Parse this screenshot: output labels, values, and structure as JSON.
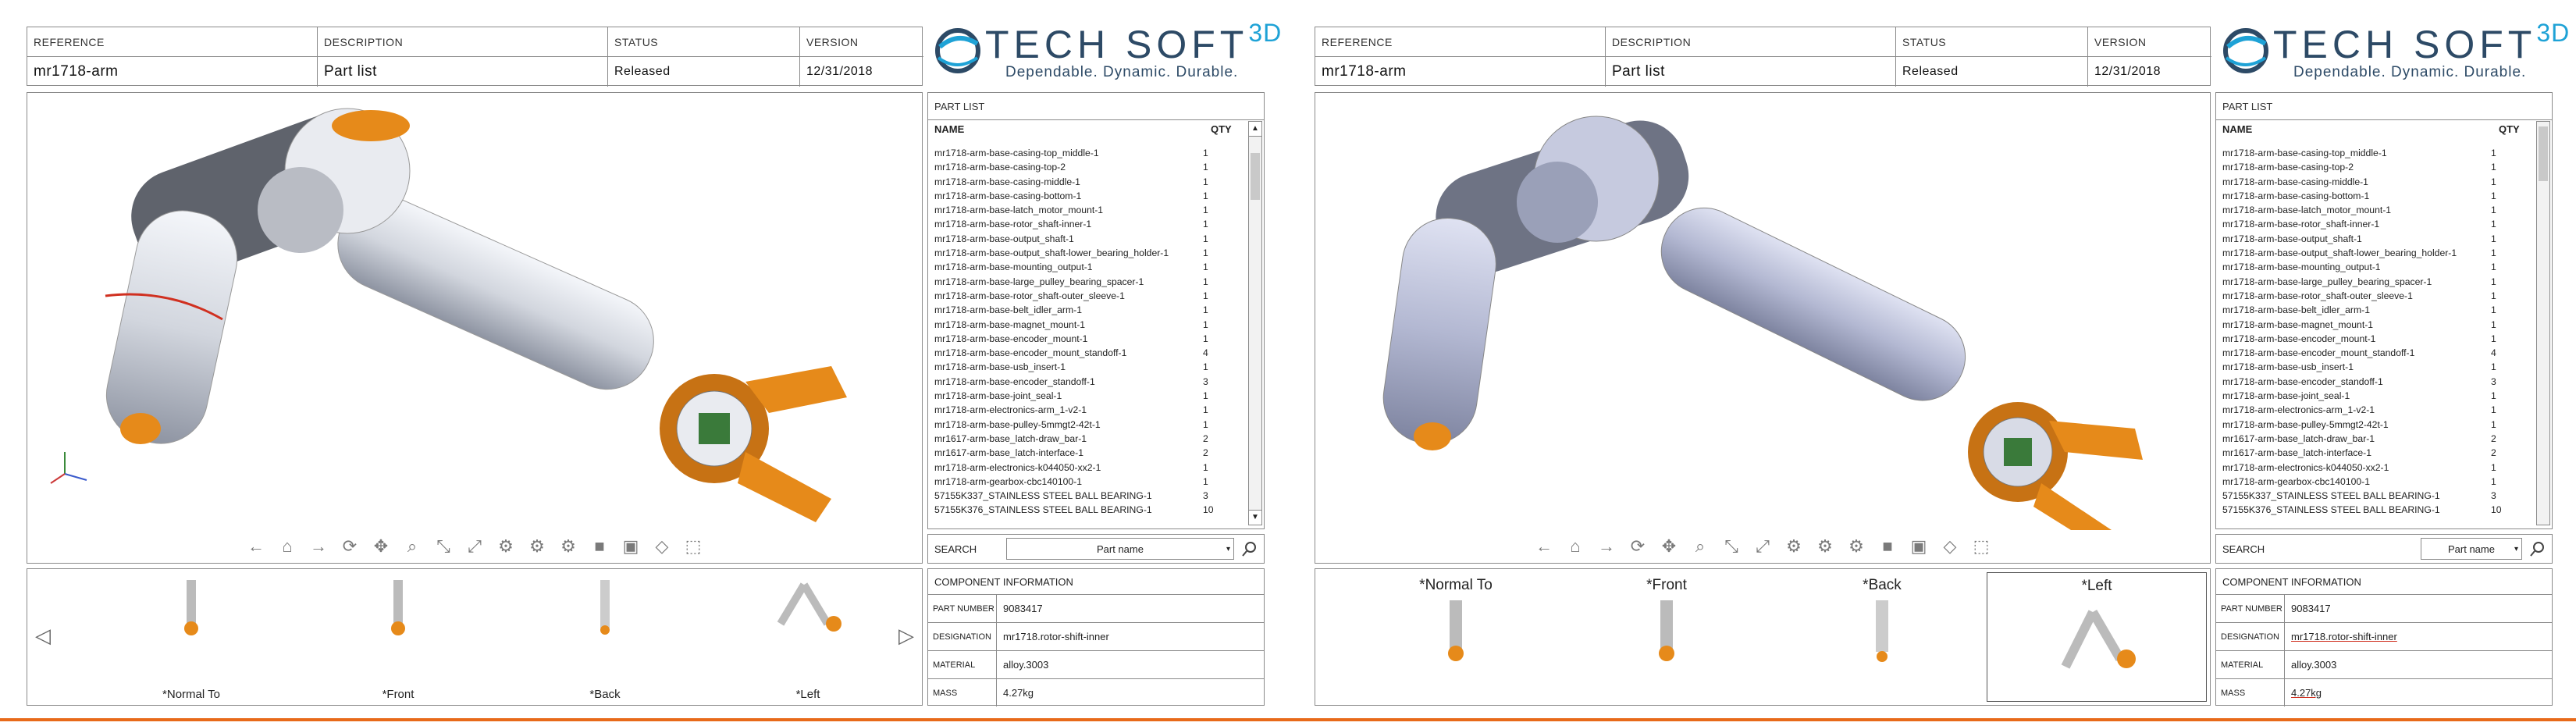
{
  "header": {
    "labels": {
      "reference": "REFERENCE",
      "description": "DESCRIPTION",
      "status": "STATUS",
      "version": "VERSION"
    },
    "values": {
      "reference": "mr1718-arm",
      "description": "Part list",
      "status": "Released",
      "version": "12/31/2018"
    }
  },
  "logo": {
    "name": "TECH SOFT",
    "suffix": "3D",
    "tagline": "Dependable. Dynamic. Durable."
  },
  "part_list": {
    "title": "PART LIST",
    "col_name": "NAME",
    "col_qty": "QTY",
    "rows": [
      {
        "name": "mr1718-arm-base-casing-top_middle-1",
        "qty": "1"
      },
      {
        "name": "mr1718-arm-base-casing-top-2",
        "qty": "1"
      },
      {
        "name": "mr1718-arm-base-casing-middle-1",
        "qty": "1"
      },
      {
        "name": "mr1718-arm-base-casing-bottom-1",
        "qty": "1"
      },
      {
        "name": "mr1718-arm-base-latch_motor_mount-1",
        "qty": "1"
      },
      {
        "name": "mr1718-arm-base-rotor_shaft-inner-1",
        "qty": "1"
      },
      {
        "name": "mr1718-arm-base-output_shaft-1",
        "qty": "1"
      },
      {
        "name": "mr1718-arm-base-output_shaft-lower_bearing_holder-1",
        "qty": "1"
      },
      {
        "name": "mr1718-arm-base-mounting_output-1",
        "qty": "1"
      },
      {
        "name": "mr1718-arm-base-large_pulley_bearing_spacer-1",
        "qty": "1"
      },
      {
        "name": "mr1718-arm-base-rotor_shaft-outer_sleeve-1",
        "qty": "1"
      },
      {
        "name": "mr1718-arm-base-belt_idler_arm-1",
        "qty": "1"
      },
      {
        "name": "mr1718-arm-base-magnet_mount-1",
        "qty": "1"
      },
      {
        "name": "mr1718-arm-base-encoder_mount-1",
        "qty": "1"
      },
      {
        "name": "mr1718-arm-base-encoder_mount_standoff-1",
        "qty": "4"
      },
      {
        "name": "mr1718-arm-base-usb_insert-1",
        "qty": "1"
      },
      {
        "name": "mr1718-arm-base-encoder_standoff-1",
        "qty": "3"
      },
      {
        "name": "mr1718-arm-base-joint_seal-1",
        "qty": "1"
      },
      {
        "name": "mr1718-arm-electronics-arm_1-v2-1",
        "qty": "1"
      },
      {
        "name": "mr1718-arm-base-pulley-5mmgt2-42t-1",
        "qty": "1"
      },
      {
        "name": "mr1617-arm-base_latch-draw_bar-1",
        "qty": "2"
      },
      {
        "name": "mr1617-arm-base_latch-interface-1",
        "qty": "2"
      },
      {
        "name": "mr1718-arm-electronics-k044050-xx2-1",
        "qty": "1"
      },
      {
        "name": "mr1718-arm-gearbox-cbc140100-1",
        "qty": "1"
      },
      {
        "name": "57155K337_STAINLESS STEEL BALL BEARING-1",
        "qty": "3"
      },
      {
        "name": "57155K376_STAINLESS STEEL BALL BEARING-1",
        "qty": "10"
      }
    ]
  },
  "search": {
    "label": "SEARCH",
    "selected": "Part name"
  },
  "views": [
    {
      "label": "*Normal To"
    },
    {
      "label": "*Front"
    },
    {
      "label": "*Back"
    },
    {
      "label": "*Left"
    }
  ],
  "component": {
    "title": "COMPONENT INFORMATION",
    "fields": [
      {
        "key": "PART NUMBER",
        "value": "9083417"
      },
      {
        "key": "DESIGNATION",
        "value": "mr1718.rotor-shift-inner"
      },
      {
        "key": "MATERIAL",
        "value": "alloy.3003"
      },
      {
        "key": "MASS",
        "value": "4.27kg"
      }
    ]
  },
  "colors": {
    "accent": "#e86a1a",
    "brand": "#2d4a66",
    "brand_light": "#1ea2d6"
  }
}
